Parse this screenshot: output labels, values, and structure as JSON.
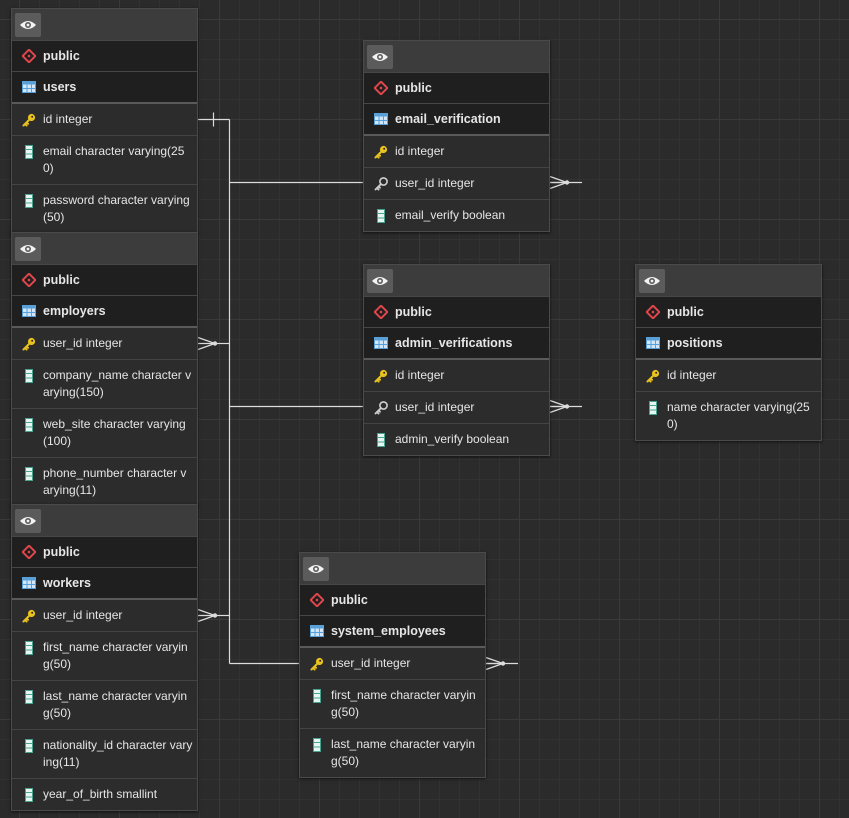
{
  "tables": [
    {
      "id": "users",
      "schema": "public",
      "name": "users",
      "columns": [
        {
          "text": "id integer",
          "kind": "pk"
        },
        {
          "text": "email character varying(250)",
          "kind": "col"
        },
        {
          "text": "password character varying(50)",
          "kind": "col"
        }
      ]
    },
    {
      "id": "employers",
      "schema": "public",
      "name": "employers",
      "columns": [
        {
          "text": "user_id integer",
          "kind": "pk"
        },
        {
          "text": "company_name character varying(150)",
          "kind": "col"
        },
        {
          "text": "web_site character varying(100)",
          "kind": "col"
        },
        {
          "text": "phone_number character varying(11)",
          "kind": "col"
        }
      ]
    },
    {
      "id": "workers",
      "schema": "public",
      "name": "workers",
      "columns": [
        {
          "text": "user_id integer",
          "kind": "pk"
        },
        {
          "text": "first_name character varying(50)",
          "kind": "col"
        },
        {
          "text": "last_name character varying(50)",
          "kind": "col"
        },
        {
          "text": "nationality_id character varying(11)",
          "kind": "col"
        },
        {
          "text": "year_of_birth smallint",
          "kind": "col"
        }
      ]
    },
    {
      "id": "email_verification",
      "schema": "public",
      "name": "email_verification",
      "columns": [
        {
          "text": "id integer",
          "kind": "pk"
        },
        {
          "text": "user_id integer",
          "kind": "fk"
        },
        {
          "text": "email_verify boolean",
          "kind": "col"
        }
      ]
    },
    {
      "id": "admin_verifications",
      "schema": "public",
      "name": "admin_verifications",
      "columns": [
        {
          "text": "id integer",
          "kind": "pk"
        },
        {
          "text": "user_id integer",
          "kind": "fk"
        },
        {
          "text": "admin_verify boolean",
          "kind": "col"
        }
      ]
    },
    {
      "id": "positions",
      "schema": "public",
      "name": "positions",
      "columns": [
        {
          "text": "id integer",
          "kind": "pk"
        },
        {
          "text": "name character varying(250)",
          "kind": "col"
        }
      ]
    },
    {
      "id": "system_employees",
      "schema": "public",
      "name": "system_employees",
      "columns": [
        {
          "text": "user_id integer",
          "kind": "pk"
        },
        {
          "text": "first_name character varying(50)",
          "kind": "col"
        },
        {
          "text": "last_name character varying(50)",
          "kind": "col"
        }
      ]
    }
  ],
  "relationships": [
    {
      "from": "users.id",
      "to": "employers.user_id",
      "cardinality": "one-to-many"
    },
    {
      "from": "users.id",
      "to": "workers.user_id",
      "cardinality": "one-to-many"
    },
    {
      "from": "users.id",
      "to": "email_verification.user_id",
      "cardinality": "one-to-many"
    },
    {
      "from": "users.id",
      "to": "admin_verifications.user_id",
      "cardinality": "one-to-many"
    },
    {
      "from": "users.id",
      "to": "system_employees.user_id",
      "cardinality": "one-to-many"
    }
  ],
  "colors": {
    "canvas": "#2b2b2b",
    "table_header": "#1f1f1f",
    "key_icon": "#e8c21e",
    "schema_icon": "#e0474c",
    "table_icon": "#5aa0d8",
    "column_icon": "#7fd3c0",
    "link": "#dcdcdc"
  },
  "icons": {
    "view": "eye-icon",
    "schema": "schema-diamond-icon",
    "table": "table-grid-icon",
    "primary_key": "key-icon",
    "foreign_key": "foreign-key-icon",
    "column": "column-icon"
  }
}
